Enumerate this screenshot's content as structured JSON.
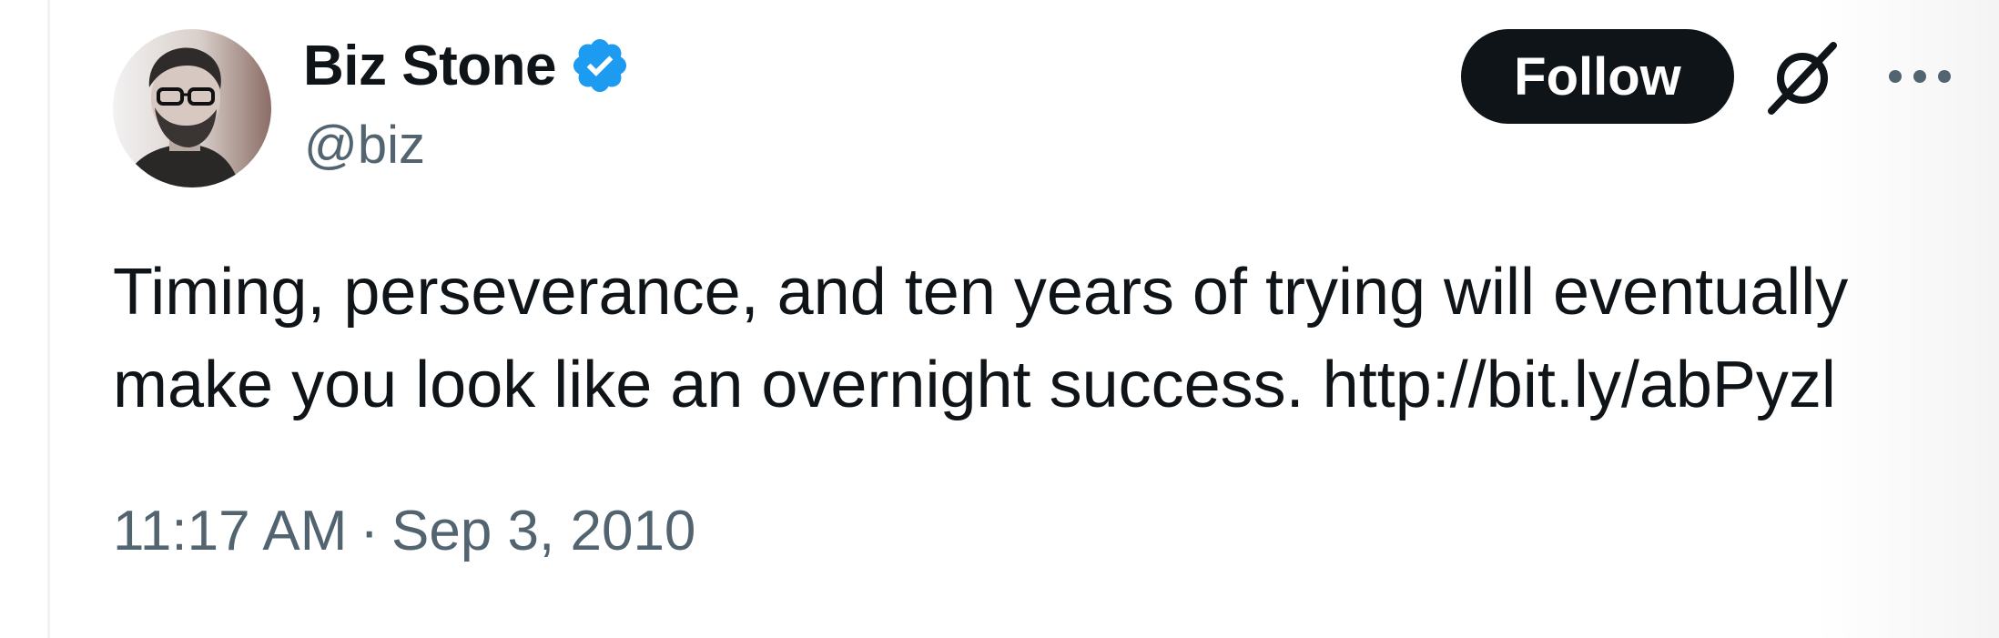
{
  "author": {
    "display_name": "Biz Stone",
    "handle": "@biz",
    "verified": true,
    "verified_color": "#1d9bf0"
  },
  "actions": {
    "follow_label": "Follow",
    "grok_icon": "grok-icon",
    "more_icon": "more-options-icon"
  },
  "tweet": {
    "text": "Timing, perseverance, and ten years of trying will eventually\nmake you look like an overnight success. ",
    "link": "http://bit.ly/abPyzl",
    "time": "11:17 AM",
    "separator": "·",
    "date": "Sep 3, 2010"
  },
  "colors": {
    "text_primary": "#0f1419",
    "text_secondary": "#536471",
    "button_bg": "#0f1419"
  }
}
